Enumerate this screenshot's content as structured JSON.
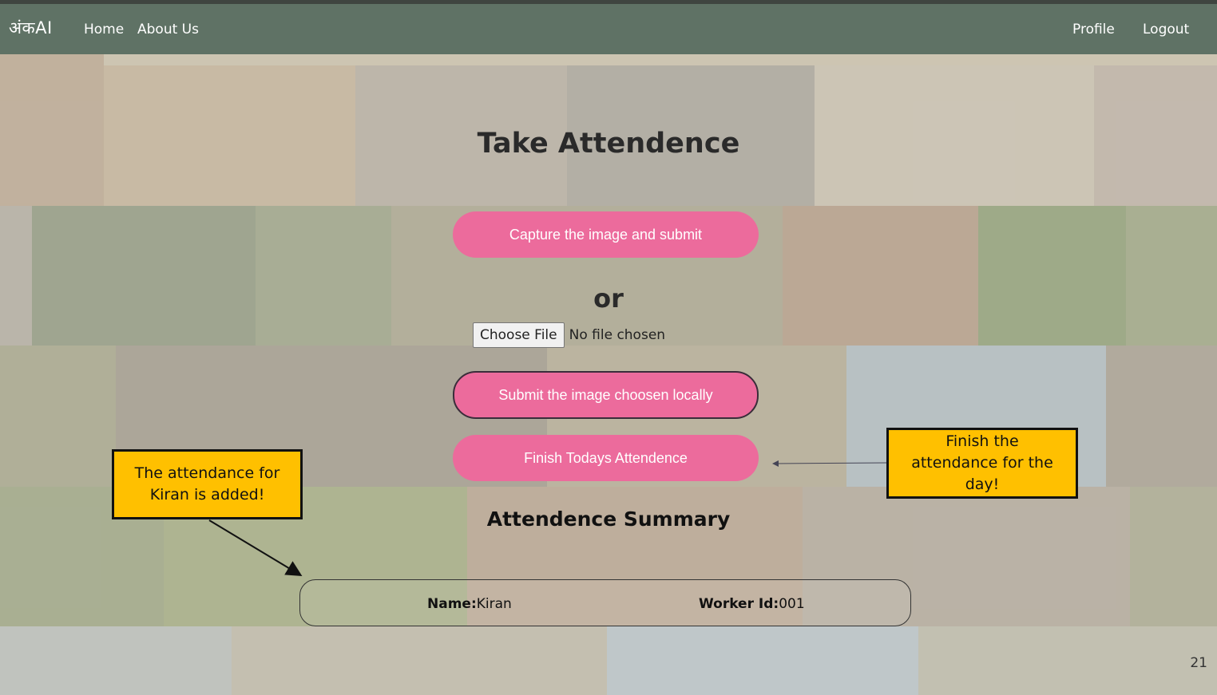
{
  "navbar": {
    "brand": "अंकAI",
    "links": [
      "Home",
      "About Us"
    ],
    "right_links": [
      "Profile",
      "Logout"
    ]
  },
  "main": {
    "title": "Take Attendence",
    "capture_button": "Capture the image and submit",
    "or_text": "or",
    "file_input": {
      "button_label": "Choose File",
      "status": "No file chosen"
    },
    "submit_button": "Submit the image choosen locally",
    "finish_button": "Finish Todays Attendence",
    "summary_title": "Attendence Summary",
    "summary": {
      "name_label": "Name:",
      "name_value": "Kiran",
      "worker_label": "Worker Id:",
      "worker_value": "001"
    }
  },
  "callouts": {
    "left_text": "The attendance for Kiran is added!",
    "right_text": "Finish the attendance for the day!"
  },
  "page_number": "21",
  "colors": {
    "navbar": "#5f7265",
    "button_pink": "#ec6b9c",
    "callout_yellow": "#ffc000"
  }
}
